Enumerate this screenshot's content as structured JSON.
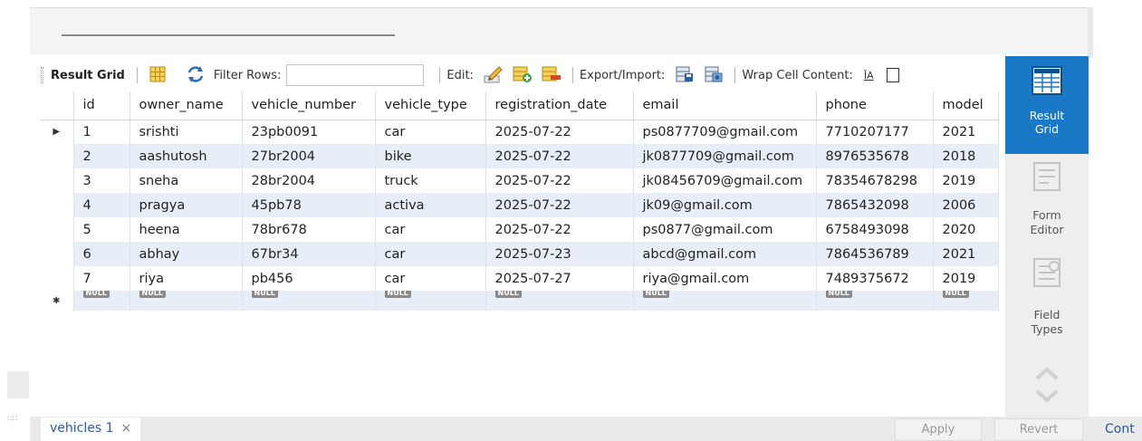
{
  "toolbar": {
    "result_grid_label": "Result Grid",
    "filter_rows_label": "Filter Rows:",
    "filter_rows_value": "",
    "edit_label": "Edit:",
    "export_import_label": "Export/Import:",
    "wrap_cell_label": "Wrap Cell Content:",
    "wrap_icon_text": "ĪA"
  },
  "grid": {
    "columns": [
      "id",
      "owner_name",
      "vehicle_number",
      "vehicle_type",
      "registration_date",
      "email",
      "phone",
      "model"
    ],
    "rows": [
      [
        "1",
        "srishti",
        "23pb0091",
        "car",
        "2025-07-22",
        "ps0877709@gmail.com",
        "7710207177",
        "2021"
      ],
      [
        "2",
        "aashutosh",
        "27br2004",
        "bike",
        "2025-07-22",
        "jk0877709@gmail.com",
        "8976535678",
        "2018"
      ],
      [
        "3",
        "sneha",
        "28br2004",
        "truck",
        "2025-07-22",
        "jk08456709@gmail.com",
        "78354678298",
        "2019"
      ],
      [
        "4",
        "pragya",
        "45pb78",
        "activa",
        "2025-07-22",
        "jk09@gmail.com",
        "7865432098",
        "2006"
      ],
      [
        "5",
        "heena",
        "78br678",
        "car",
        "2025-07-22",
        "ps0877@gmail.com",
        "6758493098",
        "2020"
      ],
      [
        "6",
        "abhay",
        "67br34",
        "car",
        "2025-07-23",
        "abcd@gmail.com",
        "7864536789",
        "2021"
      ],
      [
        "7",
        "riya",
        "pb456",
        "car",
        "2025-07-27",
        "riya@gmail.com",
        "7489375672",
        "2019"
      ]
    ],
    "null_label": "NULL",
    "current_row_marker": "▶",
    "new_row_marker": "✱"
  },
  "side_panel": {
    "result_grid": "Result Grid",
    "form_editor": "Form Editor",
    "field_types": "Field Types"
  },
  "bottom": {
    "tab_label": "vehicles 1",
    "tab_close": "×",
    "apply_label": "Apply",
    "revert_label": "Revert",
    "cont_label": "Cont"
  },
  "colors": {
    "accent": "#1a79c7",
    "row_alt": "#e8eef8",
    "null_badge": "#8a8a8a"
  }
}
